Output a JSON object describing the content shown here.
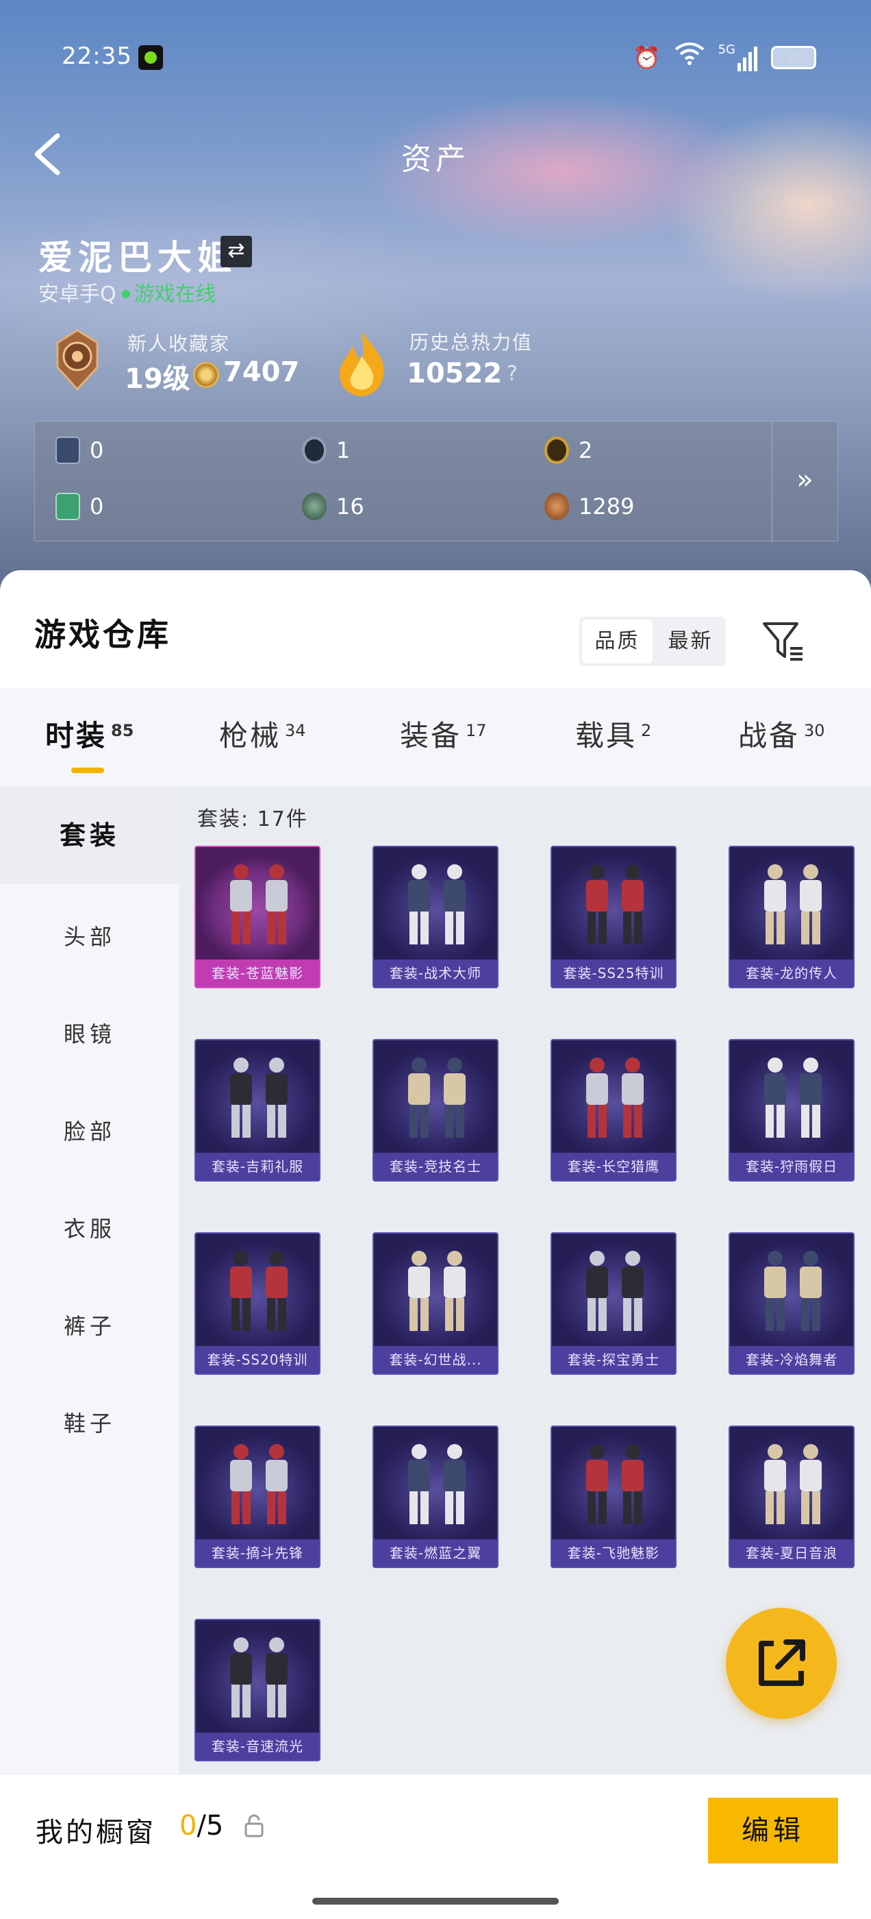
{
  "status_bar": {
    "time": "22:35",
    "network": "5G",
    "battery": "39"
  },
  "header": {
    "title": "资产"
  },
  "profile": {
    "username": "爱泥巴大姐",
    "platform": "安卓手Q",
    "online_status": "游戏在线",
    "medal_title": "新人收藏家",
    "level": "19级",
    "coins": "7407",
    "heat_title": "历史总热力值",
    "heat_value": "10522",
    "heat_help": "?"
  },
  "currencies": [
    {
      "icon": "card-icon",
      "value": "0",
      "color": "#3a4a6a"
    },
    {
      "icon": "silver-coin-icon",
      "value": "1",
      "color": "#8ea0b5"
    },
    {
      "icon": "gold-coin-icon",
      "value": "2",
      "color": "#d4a030"
    },
    {
      "icon": "green-card-icon",
      "value": "0",
      "color": "#3ca070"
    },
    {
      "icon": "dark-orb-icon",
      "value": "16",
      "color": "#4a6a5a"
    },
    {
      "icon": "bronze-coin-icon",
      "value": "1289",
      "color": "#b86a30"
    }
  ],
  "currency_more": "»",
  "warehouse": {
    "title": "游戏仓库",
    "sort_options": [
      "品质",
      "最新"
    ],
    "tabs": [
      {
        "label": "时装",
        "count": "85"
      },
      {
        "label": "枪械",
        "count": "34"
      },
      {
        "label": "装备",
        "count": "17"
      },
      {
        "label": "载具",
        "count": "2"
      },
      {
        "label": "战备",
        "count": "30"
      }
    ],
    "categories": [
      "套装",
      "头部",
      "眼镜",
      "脸部",
      "衣服",
      "裤子",
      "鞋子"
    ],
    "count_label": "套装: 17件",
    "items": [
      {
        "name": "套装-苍蓝魅影",
        "rarity": "epic"
      },
      {
        "name": "套装-战术大师",
        "rarity": "rare"
      },
      {
        "name": "套装-SS25特训",
        "rarity": "rare"
      },
      {
        "name": "套装-龙的传人",
        "rarity": "rare"
      },
      {
        "name": "套装-吉莉礼服",
        "rarity": "rare"
      },
      {
        "name": "套装-竞技名士",
        "rarity": "rare"
      },
      {
        "name": "套装-长空猎鹰",
        "rarity": "rare"
      },
      {
        "name": "套装-狩雨假日",
        "rarity": "rare"
      },
      {
        "name": "套装-SS20特训",
        "rarity": "rare"
      },
      {
        "name": "套装-幻世战...",
        "rarity": "rare"
      },
      {
        "name": "套装-探宝勇士",
        "rarity": "rare"
      },
      {
        "name": "套装-冷焰舞者",
        "rarity": "rare"
      },
      {
        "name": "套装-摘斗先锋",
        "rarity": "rare"
      },
      {
        "name": "套装-燃蓝之翼",
        "rarity": "rare"
      },
      {
        "name": "套装-飞驰魅影",
        "rarity": "rare"
      },
      {
        "name": "套装-夏日音浪",
        "rarity": "rare"
      },
      {
        "name": "套装-音速流光",
        "rarity": "rare"
      }
    ]
  },
  "showcase": {
    "label": "我的橱窗",
    "current": "0",
    "total": "/5",
    "edit_label": "编辑"
  },
  "colors": {
    "accent": "#f8b800",
    "card_bg": "#2e2766",
    "epic": "#c13cb2",
    "online": "#41d16c"
  }
}
